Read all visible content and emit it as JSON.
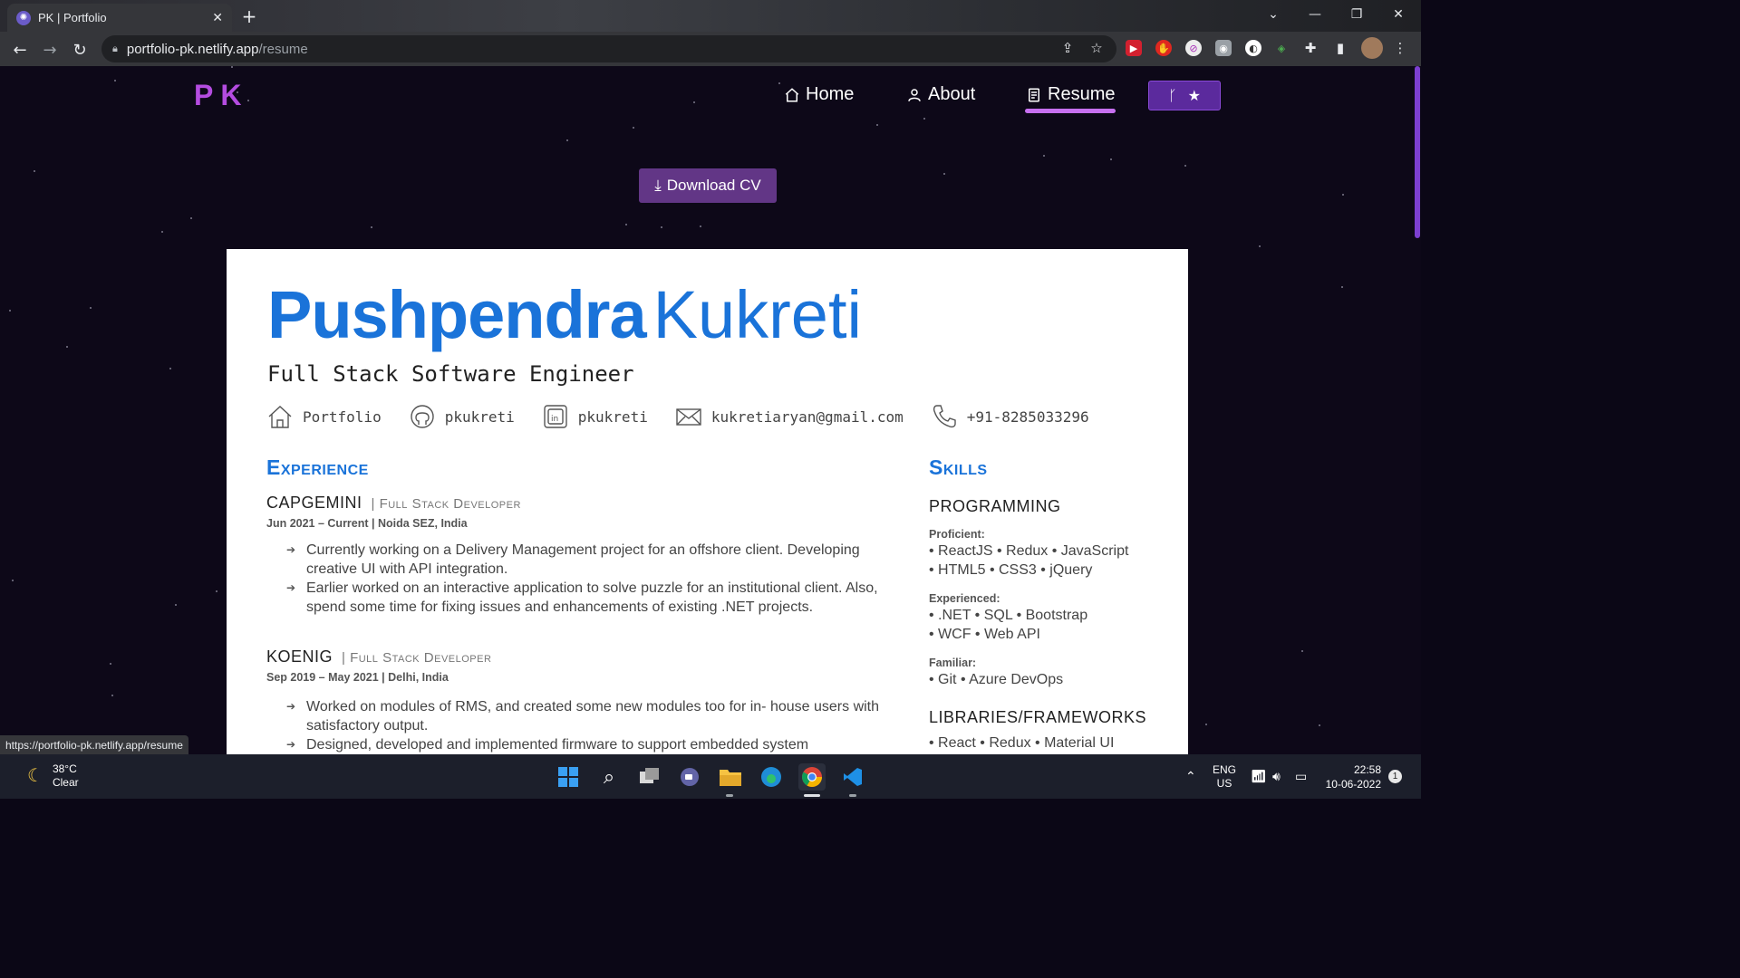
{
  "browser": {
    "tab_title": "PK | Portfolio",
    "url_host": "portfolio-pk.netlify.app",
    "url_path": "/resume",
    "status_url": "https://portfolio-pk.netlify.app/resume"
  },
  "site": {
    "logo": "PK",
    "nav": [
      {
        "label": "Home",
        "icon": "home-icon"
      },
      {
        "label": "About",
        "icon": "user-icon"
      },
      {
        "label": "Resume",
        "icon": "document-icon",
        "active": true
      }
    ],
    "github_button_icons": [
      "git-fork-icon",
      "star-icon"
    ],
    "download_label": "Download CV",
    "accent_color": "#c770f0"
  },
  "resume": {
    "first_name": "Pushpendra",
    "last_name": "Kukreti",
    "title": "Full Stack Software Engineer",
    "contacts": [
      {
        "icon": "home-icon",
        "text": "Portfolio"
      },
      {
        "icon": "github-icon",
        "text": "pkukreti"
      },
      {
        "icon": "linkedin-icon",
        "text": "pkukreti"
      },
      {
        "icon": "mail-icon",
        "text": "kukretiaryan@gmail.com"
      },
      {
        "icon": "phone-icon",
        "text": "+91-8285033296"
      }
    ],
    "experience_title": "Experience",
    "jobs": [
      {
        "company": "CAPGEMINI",
        "role": "| Full Stack Developer",
        "meta": "Jun 2021 – Current | Noida SEZ, India",
        "bullets": [
          "Currently working on a Delivery Management project for an offshore client. Developing creative UI with API integration.",
          "Earlier worked on an interactive application to solve puzzle for an institutional client. Also, spend some time for fixing issues and enhancements of existing .NET projects."
        ]
      },
      {
        "company": "KOENIG",
        "role": "| Full Stack Developer",
        "meta": "Sep 2019 – May 2021 | Delhi, India",
        "bullets": [
          "Worked on modules of RMS, and created some new modules too for in- house users with satisfactory output.",
          "Designed, developed and implemented firmware to support embedded system"
        ]
      }
    ],
    "skills_title": "Skills",
    "programming_title": "PROGRAMMING",
    "levels": [
      {
        "label": "Proficient:",
        "lines": [
          "• ReactJS • Redux • JavaScript",
          "• HTML5 • CSS3 • jQuery"
        ]
      },
      {
        "label": "Experienced:",
        "lines": [
          "• .NET • SQL • Bootstrap",
          "• WCF • Web API"
        ]
      },
      {
        "label": "Familiar:",
        "lines": [
          "• Git • Azure DevOps"
        ]
      }
    ],
    "frameworks_title": "LIBRARIES/FRAMEWORKS",
    "frameworks_line": "• React • Redux • Material UI"
  },
  "taskbar": {
    "temperature": "38°C",
    "weather": "Clear",
    "lang": "ENG",
    "region": "US",
    "time": "22:58",
    "date": "10-06-2022",
    "notification_count": "1"
  }
}
